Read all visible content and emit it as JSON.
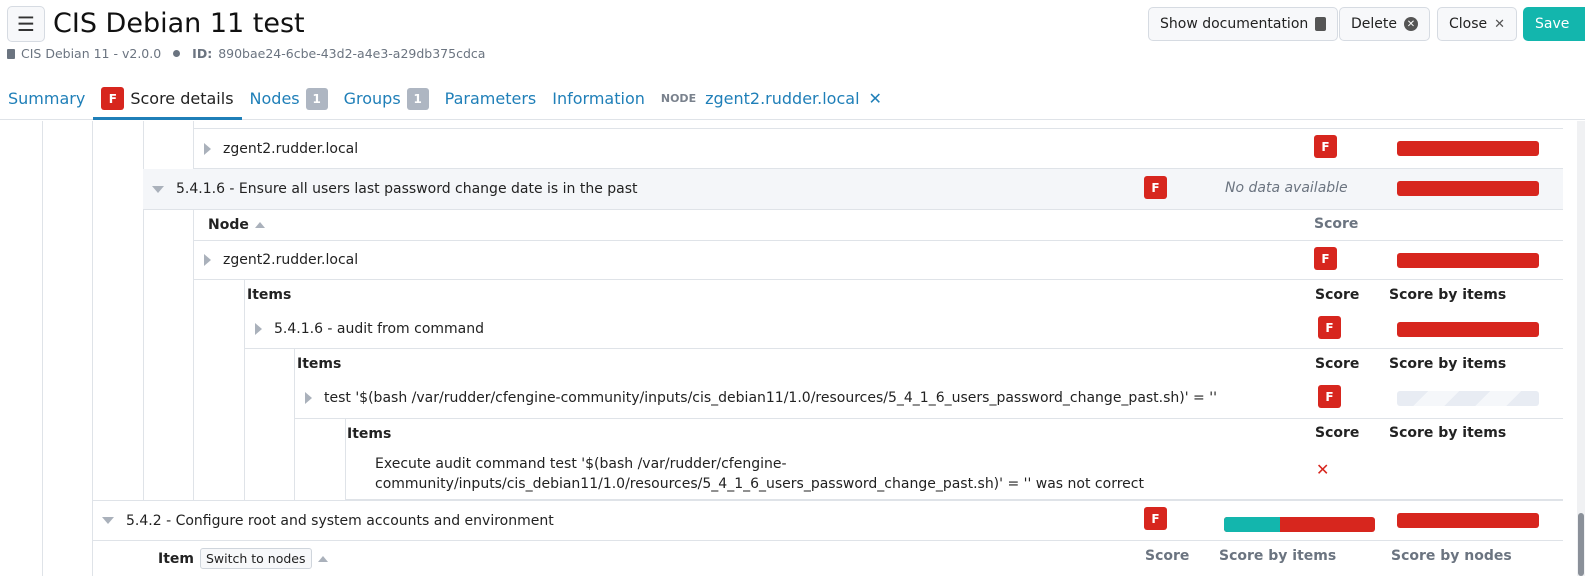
{
  "header": {
    "title": "CIS Debian 11 test",
    "version": "CIS Debian 11 - v2.0.0",
    "id_label": "ID:",
    "id_value": "890bae24-6cbe-43d2-a4e3-a29db375cdca",
    "buttons": {
      "show_doc": "Show documentation",
      "delete": "Delete",
      "close": "Close",
      "save": "Save"
    }
  },
  "tabs": {
    "summary": "Summary",
    "score_badge": "F",
    "score_details": "Score details",
    "nodes": "Nodes",
    "nodes_count": "1",
    "groups": "Groups",
    "groups_count": "1",
    "parameters": "Parameters",
    "information": "Information",
    "node_prefix": "NODE",
    "node_name": "zgent2.rudder.local"
  },
  "rows": {
    "r1_node": "zgent2.rudder.local",
    "r2_rule": "5.4.1.6 - Ensure all users last password change date is in the past",
    "r2_nodata": "No data available",
    "r3_node_head": "Node",
    "r3_score_head": "Score",
    "r4_node": "zgent2.rudder.local",
    "r5_items": "Items",
    "r5_score": "Score",
    "r5_score_items": "Score by items",
    "r6_item": "5.4.1.6 - audit from command",
    "r7_items": "Items",
    "r7_score": "Score",
    "r7_score_items": "Score by items",
    "r8_test": "test '$(bash /var/rudder/cfengine-community/inputs/cis_debian11/1.0/resources/5_4_1_6_users_password_change_past.sh)' = ''",
    "r9_items": "Items",
    "r9_score": "Score",
    "r9_score_items": "Score by items",
    "r10_line1": "Execute audit command test '$(bash /var/rudder/cfengine-",
    "r10_line2": "community/inputs/cis_debian11/1.0/resources/5_4_1_6_users_password_change_past.sh)' = '' was not correct",
    "r11_rule": "5.4.2 - Configure root and system accounts and environment",
    "r12_item": "Item",
    "r12_switch": "Switch to nodes",
    "r12_score": "Score",
    "r12_score_items": "Score by items",
    "r12_score_nodes": "Score by nodes",
    "f": "F",
    "x": "✕"
  },
  "colors": {
    "accent": "#1f7fb8",
    "fail": "#d7261e",
    "success": "#13b6ad"
  },
  "bars": {
    "r11_score_items_success_fraction": 0.37
  }
}
